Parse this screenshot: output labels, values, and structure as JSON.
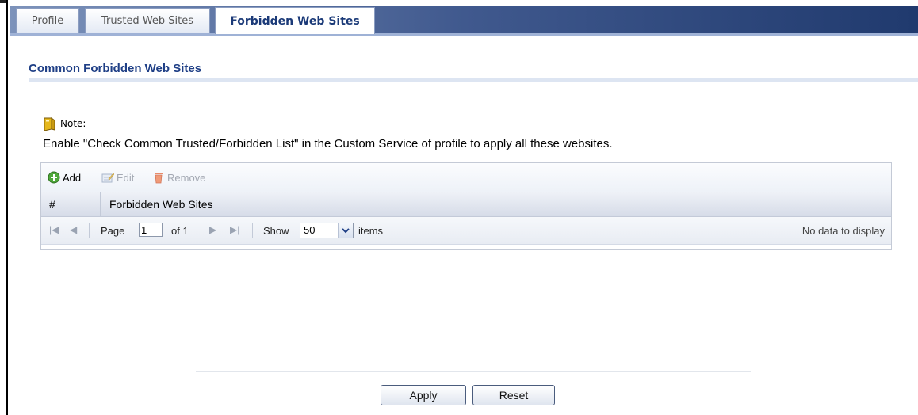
{
  "tabs": [
    {
      "label": "Profile"
    },
    {
      "label": "Trusted Web Sites"
    },
    {
      "label": "Forbidden Web Sites",
      "active": true
    }
  ],
  "section": {
    "title": "Common Forbidden Web Sites"
  },
  "note": {
    "label": "Note:",
    "text": "Enable \"Check Common Trusted/Forbidden List\" in the Custom Service of profile to apply all these websites."
  },
  "toolbar": {
    "add": "Add",
    "edit": "Edit",
    "remove": "Remove"
  },
  "table": {
    "columns": [
      "#",
      "Forbidden Web Sites"
    ],
    "rows": []
  },
  "pager": {
    "page_label": "Page",
    "page_value": "1",
    "of_label": "of 1",
    "show_label": "Show",
    "show_value": "50",
    "items_label": "items",
    "status": "No data to display"
  },
  "buttons": {
    "apply": "Apply",
    "reset": "Reset"
  },
  "colors": {
    "tabbar_dark": "#203a6e",
    "title_blue": "#1f3f86",
    "header_bg": "#d6dce8"
  },
  "icons": {
    "note": "note-icon",
    "add": "add-icon",
    "edit": "edit-icon",
    "remove": "trash-icon"
  }
}
